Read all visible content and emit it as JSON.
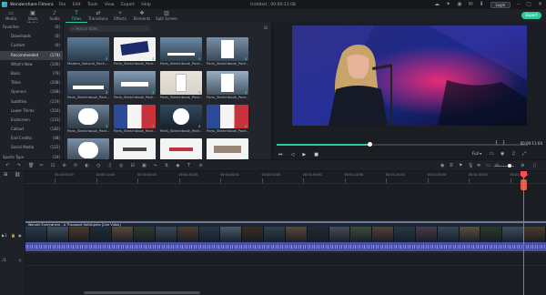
{
  "app": {
    "name": "Wondershare Filmora",
    "project": "Untitled : 00:00:11:08"
  },
  "menu": [
    "File",
    "Edit",
    "Tools",
    "View",
    "Export",
    "Help"
  ],
  "titlebar": {
    "login": "Login"
  },
  "tabs": [
    {
      "label": "Media",
      "icon": "folder-icon"
    },
    {
      "label": "Stock Media",
      "icon": "stock-icon"
    },
    {
      "label": "Audio",
      "icon": "music-icon"
    },
    {
      "label": "Titles",
      "icon": "text-icon",
      "active": true
    },
    {
      "label": "Transitions",
      "icon": "transition-icon"
    },
    {
      "label": "Effects",
      "icon": "effects-icon"
    },
    {
      "label": "Elements",
      "icon": "elements-icon"
    },
    {
      "label": "Split Screen",
      "icon": "split-icon"
    }
  ],
  "export_label": "Export",
  "categories": [
    {
      "label": "Favorites",
      "count": "(0)",
      "head": true
    },
    {
      "label": "Downloads",
      "count": "(0)"
    },
    {
      "label": "Custom",
      "count": "(0)"
    },
    {
      "label": "Recommended",
      "count": "(174)",
      "selected": true
    },
    {
      "label": "What's New",
      "count": "(100)"
    },
    {
      "label": "Basic",
      "count": "(79)"
    },
    {
      "label": "Titles",
      "count": "(208)"
    },
    {
      "label": "Openers",
      "count": "(168)"
    },
    {
      "label": "Subtitles",
      "count": "(119)"
    },
    {
      "label": "Lower Thirds",
      "count": "(316)"
    },
    {
      "label": "Endscreen",
      "count": "(133)"
    },
    {
      "label": "Callout",
      "count": "(182)"
    },
    {
      "label": "End Credits",
      "count": "(48)"
    },
    {
      "label": "Social Media",
      "count": "(122)"
    },
    {
      "label": "Sports Type",
      "count": "(19)",
      "head": true
    }
  ],
  "search": {
    "placeholder": "Search titles"
  },
  "cards": [
    {
      "label": "Modern_Natural_Pack..."
    },
    {
      "label": "Paris_Sketchbook_Pack..."
    },
    {
      "label": "Paris_Sketchbook_Pack..."
    },
    {
      "label": "Paris_Sketchbook_Pack..."
    },
    {
      "label": "Paris_Sketchbook_Pack..."
    },
    {
      "label": "Paris_Sketchbook_Pack..."
    },
    {
      "label": "Paris_Sketchbook_Pack..."
    },
    {
      "label": "Paris_Sketchbook_Pack..."
    },
    {
      "label": "Paris_Sketchbook_Pack..."
    },
    {
      "label": "Paris_Sketchbook_Pack..."
    },
    {
      "label": "Paris_Sketchbook_Pack..."
    },
    {
      "label": "Paris_Sketchbook_Pack..."
    },
    {
      "label": ""
    },
    {
      "label": ""
    },
    {
      "label": ""
    },
    {
      "label": ""
    }
  ],
  "preview": {
    "timecode": "00:00:11:04",
    "quality": "Full",
    "progress": 0.37
  },
  "timeline": {
    "ruler": [
      "00:00:00:00",
      "00:00:10:00",
      "00:00:20:00",
      "00:00:30:00",
      "00:00:40:00",
      "00:00:50:00",
      "00:01:00:00",
      "00:01:10:00",
      "00:01:20:00",
      "00:01:30:00",
      "00:01:40:00",
      "00:01:50:00"
    ],
    "clip_name": "Wonder Everywhere - A Thousand Hallelujahs [Live Video]"
  }
}
